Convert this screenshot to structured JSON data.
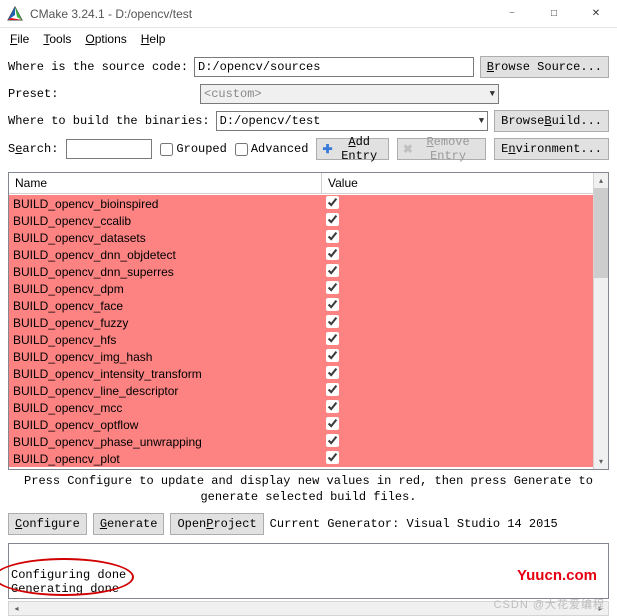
{
  "title": "CMake 3.24.1 - D:/opencv/test",
  "menu": {
    "file": "File",
    "tools": "Tools",
    "options": "Options",
    "help": "Help"
  },
  "labels": {
    "source": "Where is the source code:",
    "preset": "Preset:",
    "build": "Where to build the binaries:",
    "search": "Search:",
    "browse_source": "Browse Source...",
    "browse_build": "Browse Build...",
    "grouped": "Grouped",
    "advanced": "Advanced",
    "add_entry": "Add Entry",
    "remove_entry": "Remove Entry",
    "environment": "Environment..."
  },
  "values": {
    "source": "D:/opencv/sources",
    "preset": "<custom>",
    "build": "D:/opencv/test",
    "search": ""
  },
  "columns": {
    "name": "Name",
    "value": "Value"
  },
  "rows": [
    {
      "name": "BUILD_opencv_bioinspired",
      "checked": true
    },
    {
      "name": "BUILD_opencv_ccalib",
      "checked": true
    },
    {
      "name": "BUILD_opencv_datasets",
      "checked": true
    },
    {
      "name": "BUILD_opencv_dnn_objdetect",
      "checked": true
    },
    {
      "name": "BUILD_opencv_dnn_superres",
      "checked": true
    },
    {
      "name": "BUILD_opencv_dpm",
      "checked": true
    },
    {
      "name": "BUILD_opencv_face",
      "checked": true
    },
    {
      "name": "BUILD_opencv_fuzzy",
      "checked": true
    },
    {
      "name": "BUILD_opencv_hfs",
      "checked": true
    },
    {
      "name": "BUILD_opencv_img_hash",
      "checked": true
    },
    {
      "name": "BUILD_opencv_intensity_transform",
      "checked": true
    },
    {
      "name": "BUILD_opencv_line_descriptor",
      "checked": true
    },
    {
      "name": "BUILD_opencv_mcc",
      "checked": true
    },
    {
      "name": "BUILD_opencv_optflow",
      "checked": true
    },
    {
      "name": "BUILD_opencv_phase_unwrapping",
      "checked": true
    },
    {
      "name": "BUILD_opencv_plot",
      "checked": true
    }
  ],
  "hint": "Press Configure to update and display new values in red, then press Generate to generate selected build files.",
  "actions": {
    "configure": "Configure",
    "generate": "Generate",
    "open_project": "Open Project",
    "generator": "Current Generator: Visual Studio 14 2015"
  },
  "output_lines": [
    "Configuring done",
    "Generating done"
  ],
  "watermarks": {
    "w1": "Yuucn.com",
    "w2": "CSDN @大花爱编程"
  }
}
